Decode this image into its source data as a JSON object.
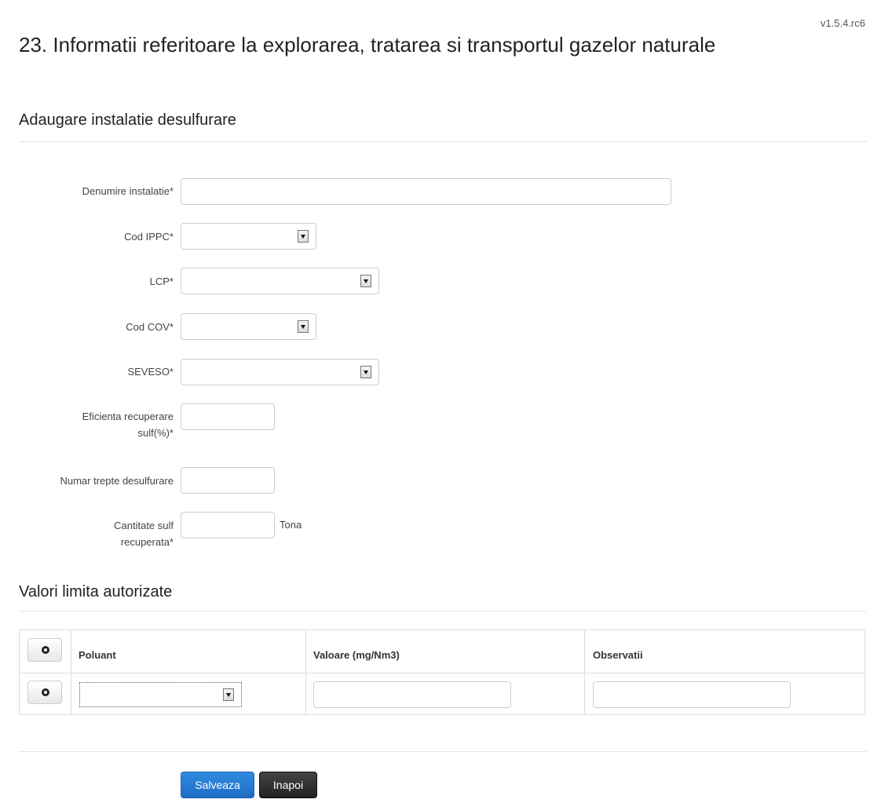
{
  "version": "v1.5.4.rc6",
  "page_title": "23. Informatii referitoare la explorarea, tratarea si transportul gazelor naturale",
  "section1_title": "Adaugare instalatie desulfurare",
  "fields": {
    "denumire": {
      "label": "Denumire instalatie*",
      "value": ""
    },
    "cod_ippc": {
      "label": "Cod IPPC*",
      "value": ""
    },
    "lcp": {
      "label": "LCP*",
      "value": ""
    },
    "cod_cov": {
      "label": "Cod COV*",
      "value": ""
    },
    "seveso": {
      "label": "SEVESO*",
      "value": ""
    },
    "eficienta": {
      "label_line1": "Eficienta recuperare",
      "label_line2": "sulf(%)*",
      "value": ""
    },
    "numar_trepte": {
      "label": "Numar trepte desulfurare",
      "value": ""
    },
    "cantitate": {
      "label_line1": "Cantitate sulf",
      "label_line2": "recuperata*",
      "value": "",
      "unit": "Tona"
    }
  },
  "section2_title": "Valori limita autorizate",
  "table": {
    "headers": {
      "poluant": "Poluant",
      "valoare": "Valoare (mg/Nm3)",
      "observatii": "Observatii"
    },
    "rows": [
      {
        "poluant": "",
        "valoare": "",
        "observatii": ""
      }
    ]
  },
  "buttons": {
    "save": "Salveaza",
    "back": "Inapoi"
  }
}
